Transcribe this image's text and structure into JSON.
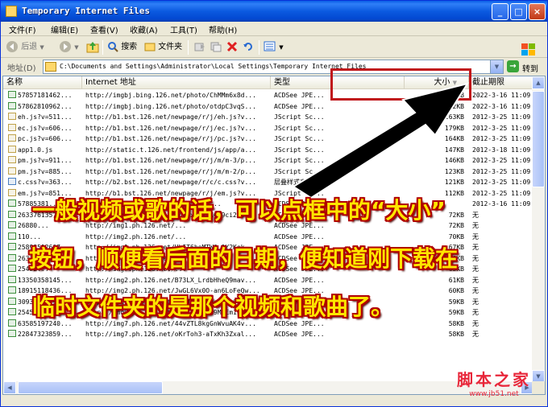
{
  "window": {
    "title": "Temporary Internet Files",
    "controls": {
      "minimize": "_",
      "maximize": "□",
      "close": "×"
    }
  },
  "menu": [
    "文件(F)",
    "编辑(E)",
    "查看(V)",
    "收藏(A)",
    "工具(T)",
    "帮助(H)"
  ],
  "toolbar": {
    "back": "后退",
    "search": "搜索",
    "folders": "文件夹"
  },
  "address": {
    "label": "地址(D)",
    "value": "C:\\Documents and Settings\\Administrator\\Local Settings\\Temporary Internet Files",
    "go": "转到"
  },
  "columns": [
    "名称",
    "Internet 地址",
    "类型",
    "大小",
    "截止期限"
  ],
  "rows": [
    {
      "name": "57857181462...",
      "url": "http://imgbj.bing.126.net/photo/ChMMm6x8d...",
      "type": "ACDSee JPE...",
      "size": "332KB",
      "exp": "2022-3-16 11:09"
    },
    {
      "name": "57862810962...",
      "url": "http://imgbj.bing.126.net/photo/otdpC3vqS...",
      "type": "ACDSee JPE...",
      "size": "312KB",
      "exp": "2022-3-16 11:09"
    },
    {
      "name": "eh.js?v=511...",
      "url": "http://b1.bst.126.net/newpage/r/j/eh.js?v...",
      "type": "JScript Sc...",
      "size": "263KB",
      "exp": "2012-3-25 11:09"
    },
    {
      "name": "ec.js?v=606...",
      "url": "http://b1.bst.126.net/newpage/r/j/ec.js?v...",
      "type": "JScript Sc...",
      "size": "179KB",
      "exp": "2012-3-25 11:09"
    },
    {
      "name": "pc.js?v=606...",
      "url": "http://b1.bst.126.net/newpage/r/j/pc.js?v...",
      "type": "JScript Sc...",
      "size": "164KB",
      "exp": "2012-3-25 11:09"
    },
    {
      "name": "app1.0.js",
      "url": "http://static.t.126.net/frontend/js/app/a...",
      "type": "JScript Sc...",
      "size": "147KB",
      "exp": "2012-3-18 11:09"
    },
    {
      "name": "pm.js?v=911...",
      "url": "http://b1.bst.126.net/newpage/r/j/m/m-3/p...",
      "type": "JScript Sc...",
      "size": "146KB",
      "exp": "2012-3-25 11:09"
    },
    {
      "name": "pm.js?v=885...",
      "url": "http://b1.bst.126.net/newpage/r/j/m/m-2/p...",
      "type": "JScript Sc...",
      "size": "123KB",
      "exp": "2012-3-25 11:09"
    },
    {
      "name": "c.css?v=363...",
      "url": "http://b2.bst.126.net/newpage/r/c/c.css?v...",
      "type": "层叠样式表...",
      "size": "121KB",
      "exp": "2012-3-25 11:09"
    },
    {
      "name": "em.js?v=851...",
      "url": "http://b1.bst.126.net/newpage/r/j/em.js?v...",
      "type": "JScript Sc...",
      "size": "112KB",
      "exp": "2012-3-25 11:09"
    },
    {
      "name": "57885381...",
      "url": "http://imgbj.bing.126.net/photo/...",
      "type": "ACDSee JPE...",
      "size": "",
      "exp": "2012-3-16 11:09"
    },
    {
      "name": "26337613570...",
      "url": "http://img1.ph.126.net/fnMaxUfITX6-9ci2kD...",
      "type": "ACDSee JPE...",
      "size": "72KB",
      "exp": "无"
    },
    {
      "name": "26880...",
      "url": "http://img1.ph.126.net/...",
      "type": "ACDSee JPE...",
      "size": "72KB",
      "exp": "无"
    },
    {
      "name": "110...",
      "url": "http://img2.ph.126.net/...",
      "type": "ACDSee JPE...",
      "size": "70KB",
      "exp": "无"
    },
    {
      "name": "25898512607...",
      "url": "http://img1.ph.126.net/UbIT6beMTW0_1Y2Kek...",
      "type": "ACDSee JPE...",
      "size": "67KB",
      "exp": "无"
    },
    {
      "name": "26327...",
      "url": "http://img1.ph.126.net/...",
      "type": "ACDSee JPE...",
      "size": "66KB",
      "exp": "无"
    },
    {
      "name": "25452...",
      "url": "http://img7.ph.126.net/...",
      "type": "ACDSee JPE...",
      "size": "63KB",
      "exp": "无"
    },
    {
      "name": "13350358145...",
      "url": "http://img2.ph.126.net/B73LX_LrdbHheQ9mav...",
      "type": "ACDSee JPE...",
      "size": "61KB",
      "exp": "无"
    },
    {
      "name": "18915118436...",
      "url": "http://img2.ph.126.net/JwGL6Vx0O-an6LoFeQw...",
      "type": "ACDSee JPE...",
      "size": "60KB",
      "exp": "无"
    },
    {
      "name": "30931285190...",
      "url": "http://img9.ph.126.net/qMfJnt0RYHsCYAe6xr...",
      "type": "ACDSee JPE...",
      "size": "59KB",
      "exp": "无"
    },
    {
      "name": "25453782144...",
      "url": "http://img9.ph.126.net/2s1iikR4t99MxEm1CC...",
      "type": "ACDSee JPE...",
      "size": "59KB",
      "exp": "无"
    },
    {
      "name": "63585197240...",
      "url": "http://img7.ph.126.net/44vZTL8kgGnWvuAK4v...",
      "type": "ACDSee JPE...",
      "size": "58KB",
      "exp": "无"
    },
    {
      "name": "22847323859...",
      "url": "http://img7.ph.126.net/oKrToh3-aTxKh3Zxal...",
      "type": "ACDSee JPE...",
      "size": "58KB",
      "exp": "无"
    }
  ],
  "annotation": {
    "line1": "一般视频或歌的话，可以点框中的“大小”",
    "line2": "按钮，顺便看后面的日期，便知道刚下载在",
    "line3": "临时文件夹的是那个视频和歌曲了。"
  },
  "watermark": {
    "logo": "脚本之家",
    "url": "www.jb51.net"
  },
  "colors": {
    "titlebar": "#0a5ee6",
    "highlight": "#c0161a",
    "annotation_text": "#ffe600",
    "annotation_outline": "#b00000"
  }
}
